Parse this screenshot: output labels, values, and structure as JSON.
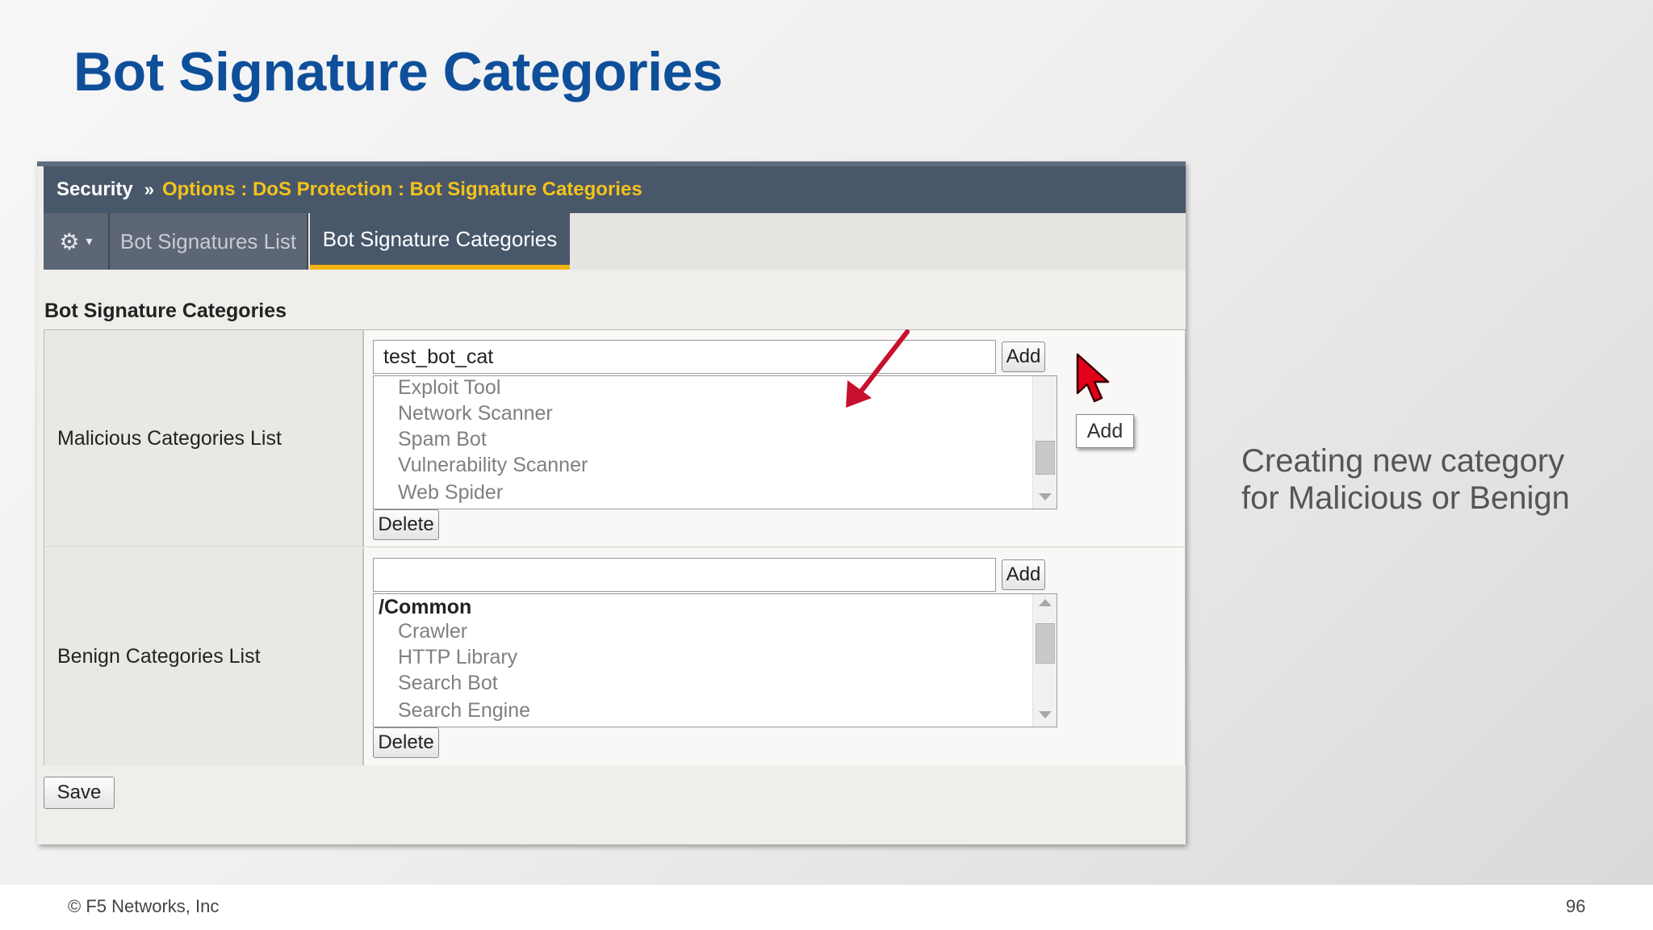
{
  "slide": {
    "title": "Bot Signature Categories",
    "side_note_lines": [
      "Creating new category",
      "for Malicious or Benign"
    ],
    "copyright": "© F5 Networks, Inc",
    "page_number": "96"
  },
  "breadcrumb": {
    "root": "Security",
    "separator": "»",
    "path": "Options : DoS Protection : Bot Signature Categories"
  },
  "tabs": {
    "gear_icon": "⚙",
    "caret_icon": "▾",
    "items": [
      {
        "label": "Bot Signatures List",
        "active": false
      },
      {
        "label": "Bot Signature Categories",
        "active": true
      }
    ]
  },
  "section": {
    "heading": "Bot Signature Categories"
  },
  "malicious": {
    "label": "Malicious Categories List",
    "input_value": "test_bot_cat",
    "add_label": "Add",
    "delete_label": "Delete",
    "tooltip": "Add",
    "items": [
      "Exploit Tool",
      "Network Scanner",
      "Spam Bot",
      "Vulnerability Scanner",
      "Web Spider"
    ]
  },
  "benign": {
    "label": "Benign Categories List",
    "input_value": "",
    "add_label": "Add",
    "delete_label": "Delete",
    "group_header": "/Common",
    "items": [
      "Crawler",
      "HTTP Library",
      "Search Bot",
      "Search Engine"
    ]
  },
  "footer_form": {
    "save_label": "Save"
  },
  "colors": {
    "title": "#0e4f9a",
    "breadcrumb_bg": "#49576a",
    "breadcrumb_path": "#f3c31b",
    "active_tab_underline": "#f3b511",
    "annotation_arrow": "#c8102e",
    "cursor": "#e2001a"
  },
  "icons": {
    "cursor": "mouse-pointer-icon",
    "annotation": "red-arrow-icon",
    "gear": "gear-icon"
  }
}
